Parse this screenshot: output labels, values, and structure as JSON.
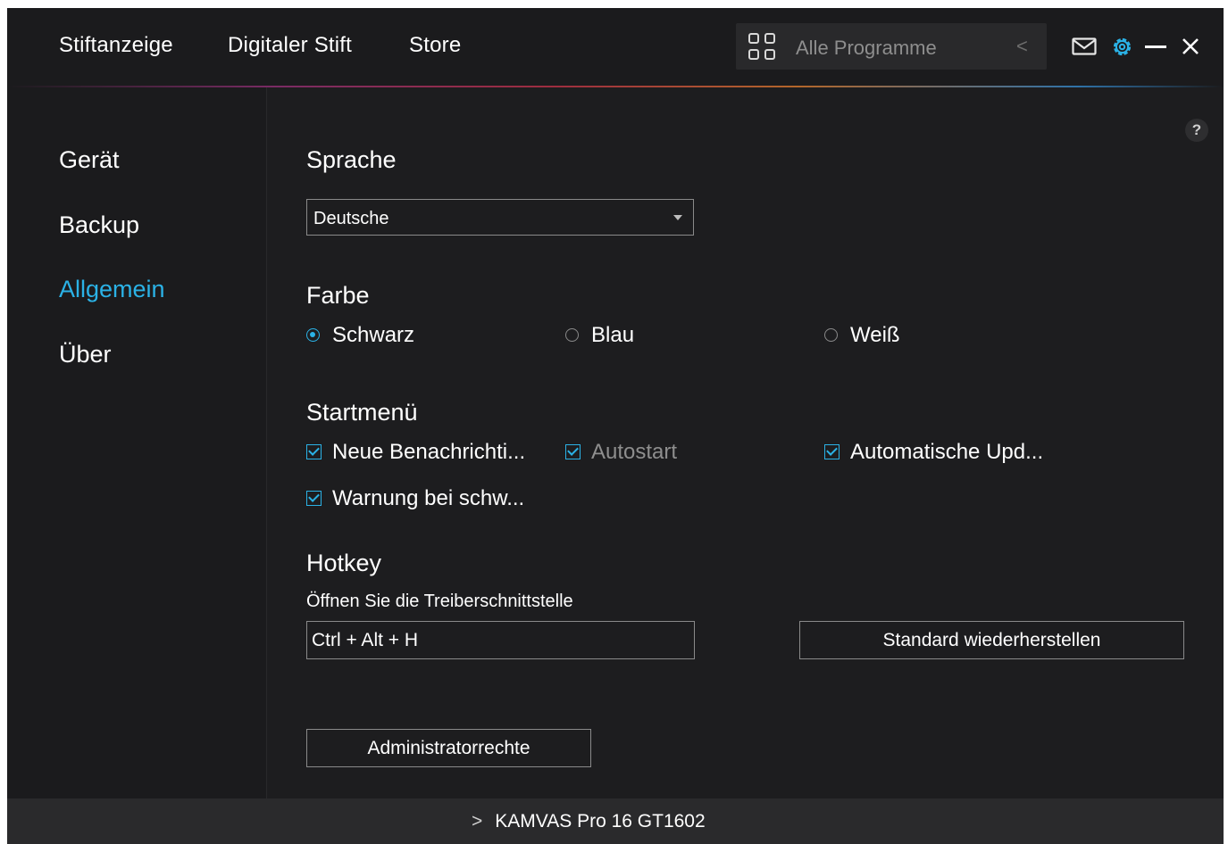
{
  "header": {
    "tabs": [
      {
        "label": "Stiftanzeige"
      },
      {
        "label": "Digitaler Stift"
      },
      {
        "label": "Store"
      }
    ],
    "program_selector": {
      "label": "Alle Programme",
      "icon": "grid-icon",
      "chevron": "<"
    },
    "icons": [
      "mail-icon",
      "gear-icon",
      "minimize-icon",
      "close-icon"
    ],
    "accent_color": "#2bb2e6"
  },
  "sidebar": {
    "items": [
      {
        "label": "Gerät",
        "active": false
      },
      {
        "label": "Backup",
        "active": false
      },
      {
        "label": "Allgemein",
        "active": true
      },
      {
        "label": "Über",
        "active": false
      }
    ]
  },
  "main": {
    "help_label": "?",
    "language": {
      "title": "Sprache",
      "selected": "Deutsche"
    },
    "color": {
      "title": "Farbe",
      "options": [
        {
          "label": "Schwarz",
          "selected": true
        },
        {
          "label": "Blau",
          "selected": false
        },
        {
          "label": "Weiß",
          "selected": false
        }
      ]
    },
    "startmenu": {
      "title": "Startmenü",
      "options": [
        {
          "label": "Neue Benachrichti...",
          "checked": true
        },
        {
          "label": "Autostart",
          "checked": true
        },
        {
          "label": "Automatische Upd...",
          "checked": true
        },
        {
          "label": "Warnung bei schw...",
          "checked": true
        }
      ]
    },
    "hotkey": {
      "title": "Hotkey",
      "description": "Öffnen Sie die Treiberschnittstelle",
      "value": "Ctrl + Alt + H",
      "restore_label": "Standard wiederherstellen"
    },
    "admin_label": "Administratorrechte"
  },
  "footer": {
    "chevron": ">",
    "device": "KAMVAS Pro 16 GT1602"
  }
}
